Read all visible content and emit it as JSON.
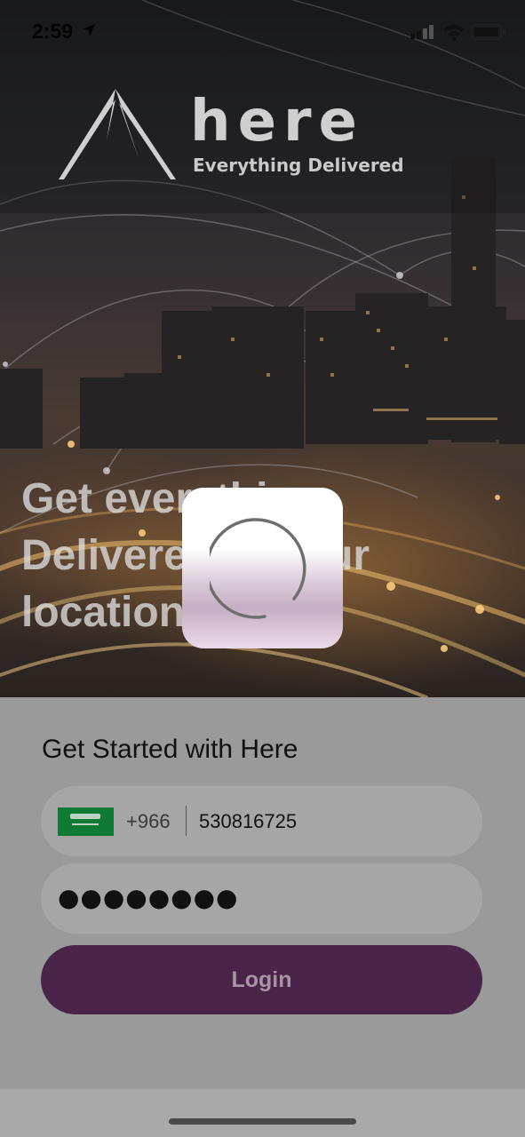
{
  "status_bar": {
    "time": "2:59",
    "icons": [
      "location-arrow-icon",
      "signal-icon",
      "wifi-icon",
      "battery-icon"
    ]
  },
  "brand": {
    "name": "here",
    "tagline": "Everything Delivered"
  },
  "hero": {
    "headline_lines": [
      "Get everything",
      "Delivered to your",
      "location"
    ]
  },
  "login_form": {
    "title": "Get Started with Here",
    "country_flag": "saudi-arabia-flag-icon",
    "country_code": "+966",
    "phone_number": "530816725",
    "password_masked": "●●●●●●●●",
    "login_label": "Login"
  },
  "loading": {
    "visible": true,
    "icon": "spinner-icon"
  },
  "colors": {
    "login_button_bg": "#4a2449",
    "login_button_text": "#a793a4",
    "sheet_bg": "#9a9a9a",
    "field_bg": "#a6a6a6"
  }
}
